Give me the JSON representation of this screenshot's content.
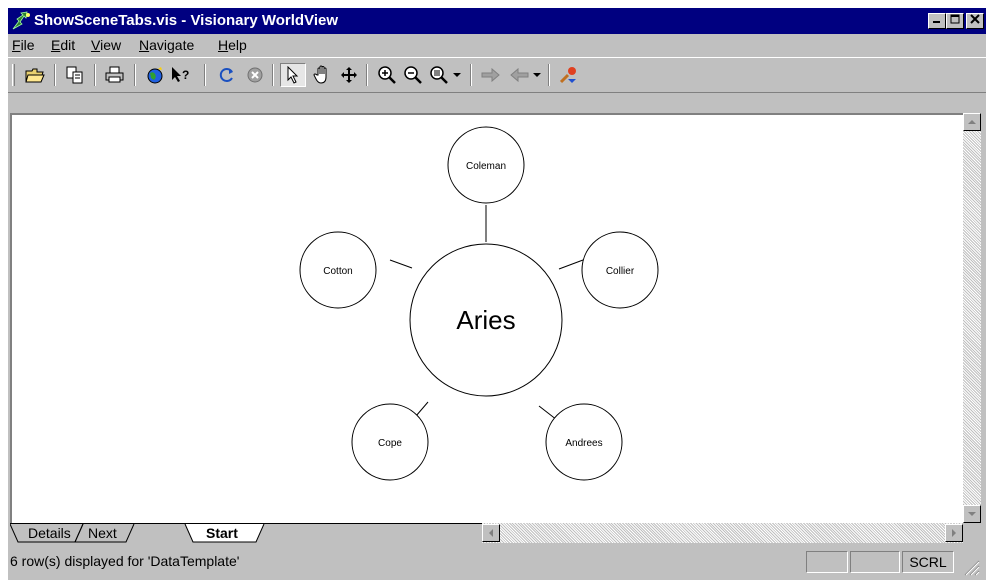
{
  "window": {
    "title": "ShowSceneTabs.vis - Visionary WorldView",
    "controls": {
      "minimize": "_",
      "maximize": "□",
      "close": "×"
    }
  },
  "menu": [
    {
      "label": "File"
    },
    {
      "label": "Edit"
    },
    {
      "label": "View"
    },
    {
      "label": "Navigate"
    },
    {
      "label": "Help"
    }
  ],
  "toolbar": {
    "icons": [
      "open-folder",
      "copy",
      "print",
      "globe",
      "help-pointer",
      "refresh",
      "stop",
      "select-arrow",
      "pan-hand",
      "move-cross",
      "zoom-in",
      "zoom-out",
      "zoom-menu",
      "forward",
      "back",
      "link"
    ]
  },
  "scene": {
    "center": {
      "label": "Aries"
    },
    "nodes": [
      {
        "label": "Coleman"
      },
      {
        "label": "Collier"
      },
      {
        "label": "Andrees"
      },
      {
        "label": "Cope"
      },
      {
        "label": "Cotton"
      }
    ]
  },
  "tabs": [
    {
      "label": "Details",
      "active": false
    },
    {
      "label": "Next",
      "active": false
    },
    {
      "label": "Start",
      "active": true
    }
  ],
  "status": {
    "message": "6 row(s) displayed for 'DataTemplate'",
    "pane3": "SCRL"
  },
  "colors": {
    "titlebar": "#000080",
    "chrome": "#c0c0c0"
  }
}
